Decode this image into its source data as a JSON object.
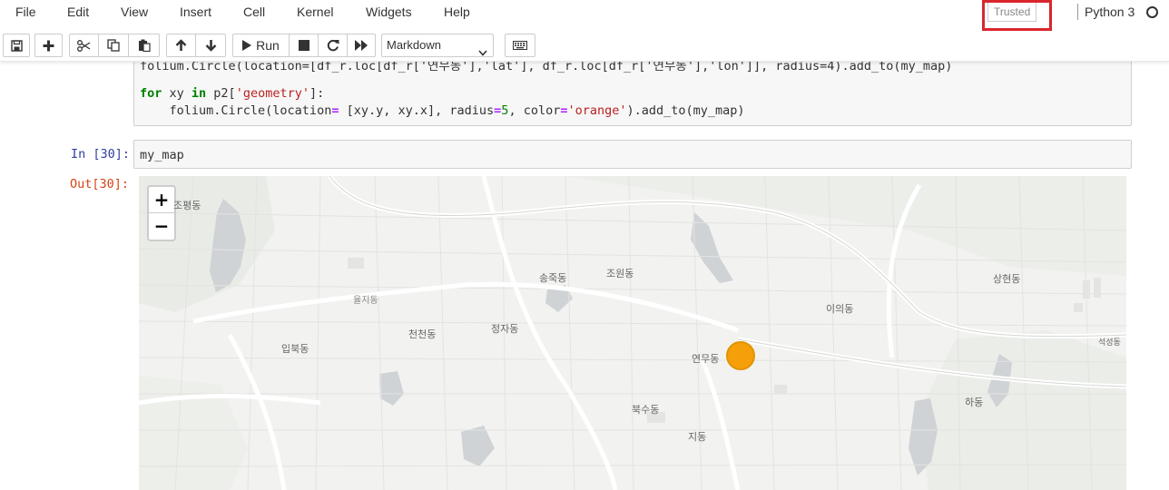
{
  "menubar": {
    "items": [
      "File",
      "Edit",
      "View",
      "Insert",
      "Cell",
      "Kernel",
      "Widgets",
      "Help"
    ],
    "trusted": "Trusted",
    "kernel": "Python 3"
  },
  "toolbar": {
    "run_label": "Run",
    "cell_type": "Markdown",
    "icons": [
      "save-icon",
      "plus-icon",
      "cut-icon",
      "copy-icon",
      "paste-icon",
      "arrow-up-icon",
      "arrow-down-icon",
      "run-icon",
      "stop-icon",
      "restart-icon",
      "fast-forward-icon",
      "keyboard-icon"
    ]
  },
  "cells": {
    "cell1": {
      "line1_partial": "folium.Circle(location=[df_r.loc[df_r['연무동'],'lat'], df_r.loc[df_r['연무동'],'lon']], radius=4).add_to(my_map)",
      "line2_kw_for": "for",
      "line2_var": " xy ",
      "line2_kw_in": "in",
      "line2_rest": " p2[",
      "line2_str": "'geometry'",
      "line2_end": "]:",
      "line3_a": "    folium.Circle(location",
      "line3_eq": "=",
      "line3_b": " [xy.y, xy.x], radius",
      "line3_eq2": "=",
      "line3_num": "5",
      "line3_c": ", color",
      "line3_eq3": "=",
      "line3_str": "'orange'",
      "line3_d": ").add_to(my_map)"
    },
    "cell2": {
      "prompt": "In [30]:",
      "code": "my_map",
      "out_prompt": "Out[30]:"
    }
  },
  "map": {
    "zoom_in": "+",
    "zoom_out": "−",
    "labels": [
      {
        "text": "조원동",
        "name": "label-jowon"
      },
      {
        "text": "송죽동",
        "name": "label-songjuk"
      },
      {
        "text": "정자동",
        "name": "label-jeongja"
      },
      {
        "text": "천천동",
        "name": "label-cheoncheon"
      },
      {
        "text": "입북동",
        "name": "label-ipbuk"
      },
      {
        "text": "연무동",
        "name": "label-yeonmu"
      },
      {
        "text": "북수동",
        "name": "label-buksu"
      },
      {
        "text": "지동",
        "name": "label-ji"
      },
      {
        "text": "이의동",
        "name": "label-iui"
      },
      {
        "text": "상현동",
        "name": "label-sanghyeon"
      },
      {
        "text": "하동",
        "name": "label-ha"
      },
      {
        "text": "조평동",
        "name": "label-jopyeong"
      },
      {
        "text": "석성동",
        "name": "label-seokseong"
      },
      {
        "text": "율지동",
        "name": "label-yulji"
      }
    ],
    "marker_color": "#f5a00a"
  }
}
